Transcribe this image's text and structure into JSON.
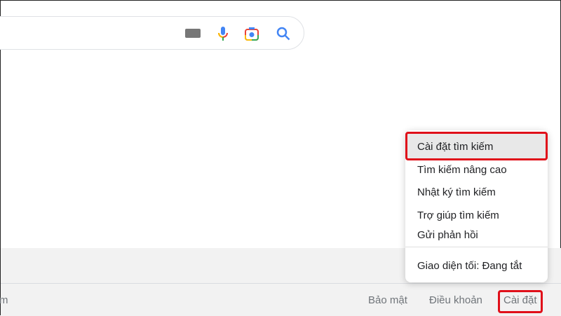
{
  "search": {
    "icons": [
      "keyboard-icon",
      "microphone-icon",
      "camera-lens-icon",
      "search-icon"
    ]
  },
  "menu": {
    "items": [
      "Cài đặt tìm kiếm",
      "Tìm kiếm nâng cao",
      "Nhật ký tìm kiếm",
      "Trợ giúp tìm kiếm",
      "Gửi phản hồi"
    ],
    "dark_mode": "Giao diện tối: Đang tắt"
  },
  "footer": {
    "left_partial": "m",
    "privacy": "Bảo mật",
    "terms": "Điều khoản",
    "settings": "Cài đặt"
  },
  "colors": {
    "highlight": "#e0101a",
    "link": "#70757a"
  }
}
